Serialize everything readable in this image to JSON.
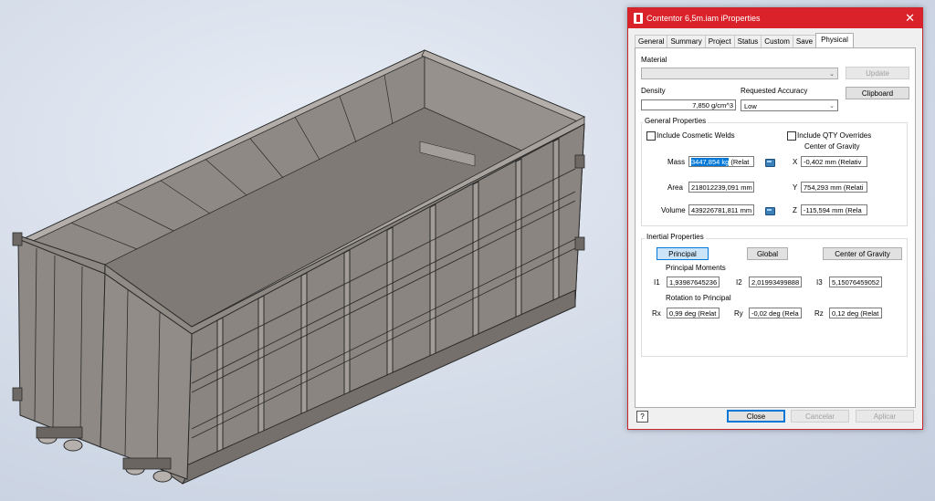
{
  "dialog": {
    "title": "Contentor 6,5m.iam iProperties",
    "close_glyph": "✕",
    "tabs": [
      "General",
      "Summary",
      "Project",
      "Status",
      "Custom",
      "Save",
      "Physical"
    ],
    "active_tab": "Physical",
    "material": {
      "label": "Material",
      "value": ""
    },
    "update_button": "Update",
    "clipboard_button": "Clipboard",
    "density": {
      "label": "Density",
      "value": "7,850 g/cm^3"
    },
    "accuracy": {
      "label": "Requested Accuracy",
      "value": "Low"
    },
    "general": {
      "title": "General Properties",
      "include_welds": "Include Cosmetic Welds",
      "include_qty": "Include QTY Overrides",
      "cog_title": "Center of Gravity",
      "mass_label": "Mass",
      "mass_value_selected": "3447,854 kg",
      "mass_value_rest": " (Relat",
      "area_label": "Area",
      "area_value": "218012239,091 mm",
      "volume_label": "Volume",
      "volume_value": "439226781,811 mm",
      "x_label": "X",
      "x_value": "-0,402 mm (Relativ",
      "y_label": "Y",
      "y_value": "754,293 mm (Relati",
      "z_label": "Z",
      "z_value": "-115,594 mm (Rela"
    },
    "inertial": {
      "title": "Inertial Properties",
      "principal_button": "Principal",
      "global_button": "Global",
      "cog_button": "Center of Gravity",
      "moments_title": "Principal Moments",
      "i1_label": "I1",
      "i1_value": "1,93987645236",
      "i2_label": "I2",
      "i2_value": "2,01993499888",
      "i3_label": "I3",
      "i3_value": "5,15076459052",
      "rotation_title": "Rotation to Principal",
      "rx_label": "Rx",
      "rx_value": "0,99 deg (Relat",
      "ry_label": "Ry",
      "ry_value": "-0,02 deg (Rela",
      "rz_label": "Rz",
      "rz_value": "0,12 deg (Relat"
    },
    "footer": {
      "help_glyph": "?",
      "close_button": "Close",
      "cancel_button": "Cancelar",
      "apply_button": "Aplicar"
    }
  },
  "colors": {
    "titlebar": "#d9222a",
    "model_face": "#8a8580",
    "model_edge": "#2a2a2a",
    "selection": "#0078d7"
  }
}
